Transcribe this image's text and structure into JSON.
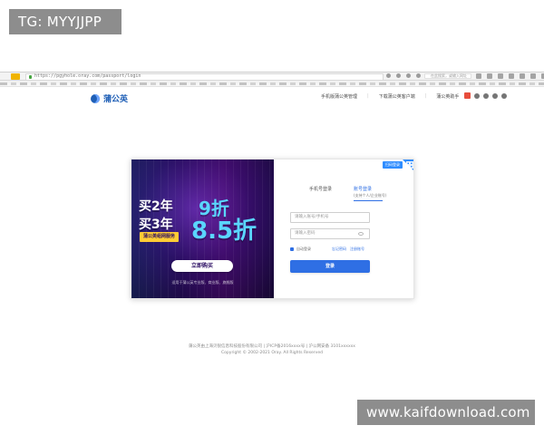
{
  "overlay_tag": {
    "text": "TG: MYYJJPP"
  },
  "watermark": {
    "text": "www.kaifdownload.com"
  },
  "browser": {
    "url_text": "https://pgyhole.oray.com/passport/login",
    "search_text": "在此搜索，或输入网址"
  },
  "site": {
    "brand": "蒲公英",
    "nav": {
      "items": [
        "手机版蒲公英管理",
        "下载蒲公英客户端",
        "蒲公英助手"
      ],
      "separator": "|"
    }
  },
  "promo": {
    "line1_prefix": "买2年",
    "line1_value": "9折",
    "line2_prefix": "买3年",
    "line2_value": "8.5折",
    "strip": "蒲公英组网服务",
    "cta": "立即购买",
    "footer": "适用于蒲公英专业版、商业版、旗舰版"
  },
  "login": {
    "corner_label": "扫码登录",
    "tabs": [
      {
        "label": "手机号登录"
      },
      {
        "label": "账号登录",
        "sub": "(支持个人/企业账号)"
      }
    ],
    "username_placeholder": "请输入账号/手机号",
    "password_placeholder": "请输入密码",
    "remember_label": "自动登录",
    "forgot_label": "忘记密码",
    "register_label": "注册账号",
    "submit_label": "登录"
  },
  "footer": {
    "line1": "蒲公英由上海贝锐信息科技股份有限公司 | 沪ICP备2016xxxx号 | 沪公网安备 3101xxxxxx",
    "line2": "Copyright © 2002-2021 Oray. All Rights Reserved"
  }
}
